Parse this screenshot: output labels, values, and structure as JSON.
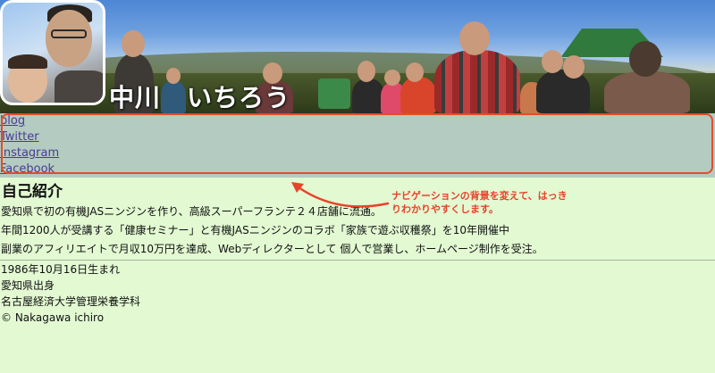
{
  "header": {
    "site_title": "中川　いちろう"
  },
  "nav": {
    "links": [
      {
        "label": "blog"
      },
      {
        "label": "Twitter"
      },
      {
        "label": "Instagram"
      },
      {
        "label": "Facebook"
      }
    ]
  },
  "main": {
    "section_title": "自己紹介",
    "paragraphs": [
      "愛知県で初の有機JASニンジンを作り、高級スーパーフランテ２４店舗に流通。",
      "年間1200人が受講する「健康セミナー」と有機JASニンジンのコラボ「家族で遊ぶ収穫祭」を10年開催中",
      "副業のアフィリエイトで月収10万円を達成、Webディレクターとして 個人で営業し、ホームページ制作を受注。"
    ],
    "info": [
      "1986年10月16日生まれ",
      "愛知県出身",
      "名古屋経済大学管理栄養学科"
    ]
  },
  "footer": {
    "copyright": "© Nakagawa ichiro"
  },
  "annotation": {
    "line1": "ナビゲーションの背景を変えて、はっき",
    "line2": "りわかりやすくします。",
    "color": "#e8432a"
  },
  "colors": {
    "page_background": "#e2f9d2",
    "nav_background": "#b3cbc0",
    "link": "#4a3a9a",
    "highlight_border": "#e84a2a"
  }
}
